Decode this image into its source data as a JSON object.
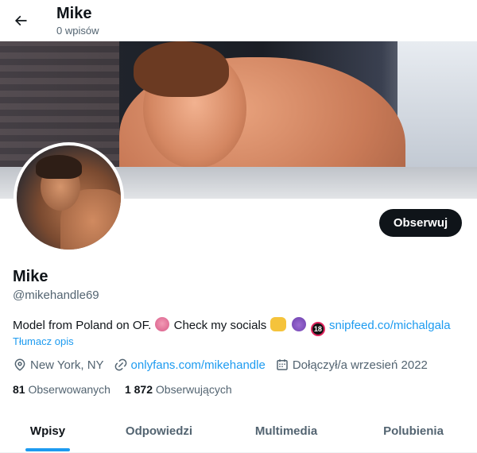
{
  "header": {
    "name": "Mike",
    "posts_count": "0 wpisów"
  },
  "profile": {
    "display_name": "Mike",
    "handle": "@mikehandle69",
    "follow_label": "Obserwuj",
    "bio": {
      "part1": "Model from Poland on OF.",
      "part2": "Check my socials",
      "link": "snipfeed.co/michalgala"
    },
    "translate_label": "Tłumacz opis",
    "location": "New York, NY",
    "website": "onlyfans.com/mikehandle",
    "joined": "Dołączył/a wrzesień 2022",
    "following_count": "81",
    "following_label": "Obserwowanych",
    "followers_count": "1 872",
    "followers_label": "Obserwujących"
  },
  "tabs": [
    {
      "label": "Wpisy",
      "active": true
    },
    {
      "label": "Odpowiedzi",
      "active": false
    },
    {
      "label": "Multimedia",
      "active": false
    },
    {
      "label": "Polubienia",
      "active": false
    }
  ],
  "icons": {
    "back": "arrow-left-icon",
    "location": "location-pin-icon",
    "link": "link-icon",
    "calendar": "calendar-icon"
  },
  "colors": {
    "accent": "#1d9bf0",
    "text": "#0f1419",
    "muted": "#536471",
    "button": "#0f1419"
  }
}
